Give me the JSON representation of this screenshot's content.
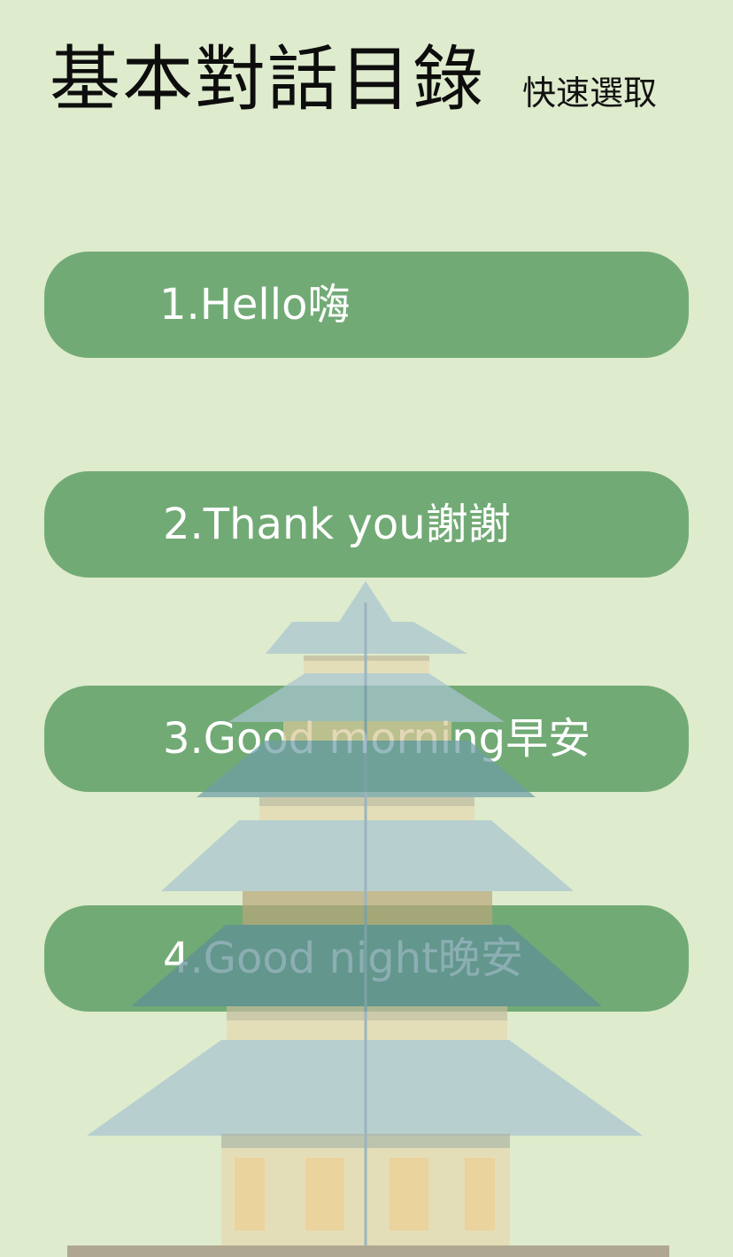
{
  "header": {
    "title": "基本對話目錄",
    "quick_select": "快速選取"
  },
  "menu": {
    "items": [
      {
        "label": "1.Hello嗨"
      },
      {
        "label": "2.Thank you謝謝"
      },
      {
        "label": "3.Good morning早安"
      },
      {
        "label": "4.Good night晚安"
      }
    ]
  },
  "theme": {
    "background": "#deebcd",
    "button": "#72aa75",
    "button_text": "#ffffff",
    "pagoda_roof": "#a8c3d0",
    "pagoda_band": "#e6d9b0"
  },
  "decoration": "pagoda-illustration"
}
